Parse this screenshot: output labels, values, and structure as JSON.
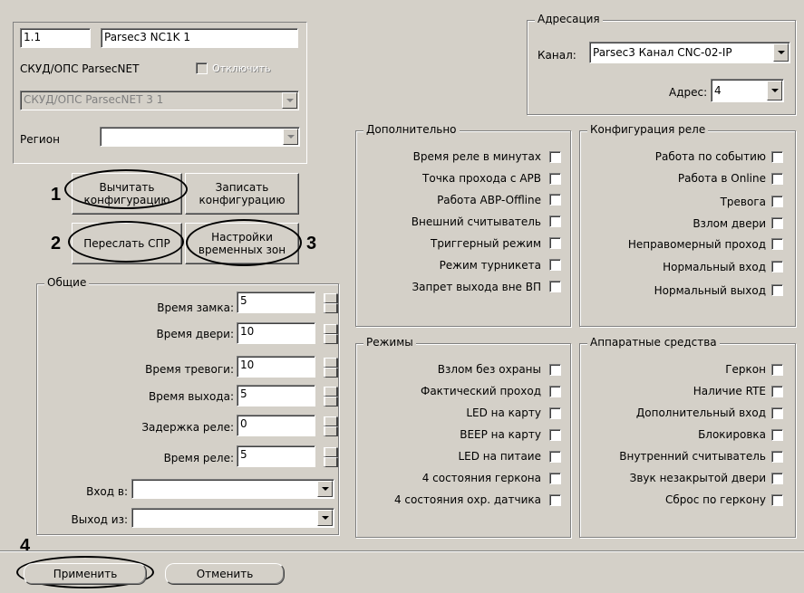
{
  "device": {
    "number": "1.1",
    "name": "Parsec3 NC1K 1",
    "parent_label": "СКУД/ОПС ParsecNET",
    "disable_label": "Отключить",
    "parent_value": "СКУД/ОПС ParsecNET 3 1",
    "region_label": "Регион",
    "region_value": ""
  },
  "actions": {
    "read_config": "Вычитать конфигурацию",
    "write_config": "Записать конфигурацию",
    "send_spr": "Переслать СПР",
    "time_zones": "Настройки временных зон"
  },
  "annotations": {
    "n1": "1",
    "n2": "2",
    "n3": "3",
    "n4": "4"
  },
  "addressing": {
    "title": "Адресация",
    "channel_label": "Канал:",
    "channel_value": "Parsec3 Канал CNC-02-IP",
    "address_label": "Адрес:",
    "address_value": "4"
  },
  "general": {
    "title": "Общие",
    "fields": [
      {
        "label": "Время замка:",
        "value": "5"
      },
      {
        "label": "Время двери:",
        "value": "10"
      },
      {
        "label": "Время тревоги:",
        "value": "10"
      },
      {
        "label": "Время выхода:",
        "value": "5"
      },
      {
        "label": "Задержка реле:",
        "value": "0"
      },
      {
        "label": "Время реле:",
        "value": "5"
      }
    ],
    "input_label": "Вход в:",
    "output_label": "Выход из:"
  },
  "additional": {
    "title": "Дополнительно",
    "items": [
      "Время реле в минутах",
      "Точка прохода с APB",
      "Работа ABP-Offline",
      "Внешний считыватель",
      "Триггерный режим",
      "Режим турникета",
      "Запрет выхода вне ВП"
    ]
  },
  "relay": {
    "title": "Конфигурация реле",
    "items": [
      "Работа по событию",
      "Работа в Online",
      "Тревога",
      "Взлом двери",
      "Неправомерный проход",
      "Нормальный вход",
      "Нормальный выход"
    ]
  },
  "modes": {
    "title": "Режимы",
    "items": [
      "Взлом без охраны",
      "Фактический проход",
      "LED на карту",
      "BEEP на карту",
      "LED на питаие",
      "4 состояния геркона",
      "4 состояния охр. датчика"
    ]
  },
  "hardware": {
    "title": "Аппаратные средства",
    "items": [
      "Геркон",
      "Наличие RTE",
      "Дополнительный вход",
      "Блокировка",
      "Внутренний считыватель",
      "Звук незакрытой двери",
      "Сброс по геркону"
    ]
  },
  "footer": {
    "apply": "Применить",
    "cancel": "Отменить"
  }
}
